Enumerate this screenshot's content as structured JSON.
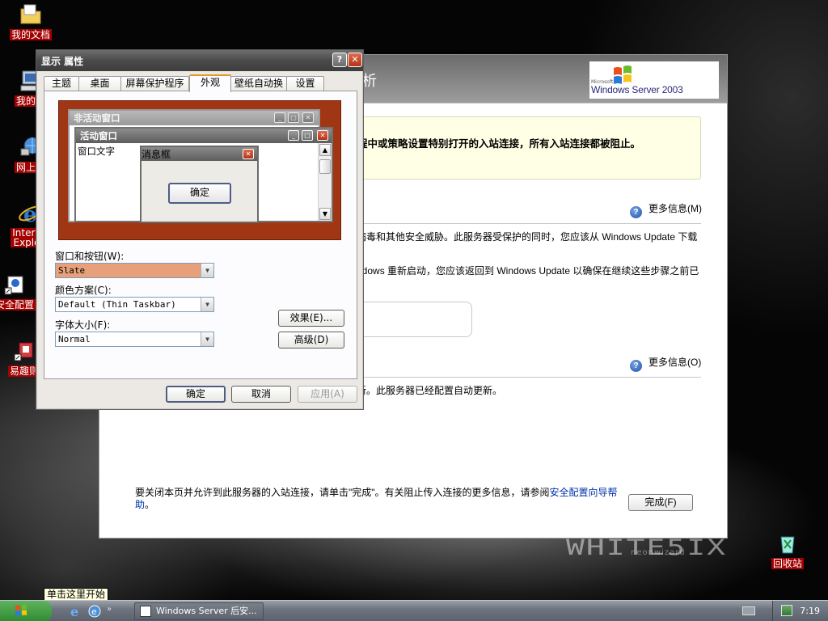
{
  "desktop": {
    "icons": [
      {
        "name": "my-documents",
        "label": "我的文档",
        "icon": "folder-icon"
      },
      {
        "name": "my-computer",
        "label": "我的电",
        "icon": "computer-icon"
      },
      {
        "name": "network",
        "label": "网上邻",
        "icon": "network-icon"
      },
      {
        "name": "internet-explorer",
        "label": "Intern Explo",
        "icon": "ie-icon"
      },
      {
        "name": "security-config",
        "label": "安全配置",
        "icon": "security-icon"
      },
      {
        "name": "easy-app",
        "label": "易趣则",
        "icon": "shortcut-icon"
      },
      {
        "name": "recycle-bin",
        "label": "回收站",
        "icon": "recycle-bin-icon"
      }
    ],
    "watermark": "WHITE5IX",
    "watermark_sub": "neonwizard"
  },
  "wizard": {
    "banner_title": "析",
    "logo_text": "Windows Server 2003",
    "logo_ms": "Microsoft",
    "warning": "程中或策略设置特别打开的入站连接，所有入站连接都被阻止。",
    "more_info_1": "更多信息(M)",
    "para1": "病毒和其他安全威胁。此服务器受保护的同时，您应该从 Windows Update 下载",
    "para2": "ndows 重新启动，您应该返回到 Windows Update 以确保在继续这些步骤之前已",
    "more_info_2": "更多信息(O)",
    "para3": "新。此服务器已经配置自动更新。",
    "bottom_text": "要关闭本页并允许到此服务器的入站连接，请单击\"完成\"。有关阻止传入连接的更多信息，请参阅",
    "bottom_link": "安全配置向导帮助",
    "bottom_end": "。",
    "finish_button": "完成(F)"
  },
  "dialog": {
    "title": "显示 属性",
    "help_button": "?",
    "close_button": "✕",
    "tabs": [
      "主题",
      "桌面",
      "屏幕保护程序",
      "外观",
      "壁纸自动换",
      "设置"
    ],
    "active_tab": "外观",
    "preview": {
      "inactive_window": "非活动窗口",
      "active_window": "活动窗口",
      "window_text": "窗口文字",
      "message_box": "消息框",
      "ok": "确定"
    },
    "windows_buttons_label": "窗口和按钮(W):",
    "windows_buttons_value": "Slate",
    "color_scheme_label": "颜色方案(C):",
    "color_scheme_value": "Default (Thin Taskbar)",
    "font_size_label": "字体大小(F):",
    "font_size_value": "Normal",
    "effects_button": "效果(E)...",
    "advanced_button": "高级(D)",
    "ok_button": "确定",
    "cancel_button": "取消",
    "apply_button": "应用(A)"
  },
  "taskbar": {
    "start_tooltip": "单击这里开始",
    "task_item": "Windows Server 后安...",
    "clock": "7:19"
  },
  "colors": {
    "preview_bg": "#a03614",
    "slate_title": "#6a6a6a",
    "label_red": "#a30000"
  }
}
